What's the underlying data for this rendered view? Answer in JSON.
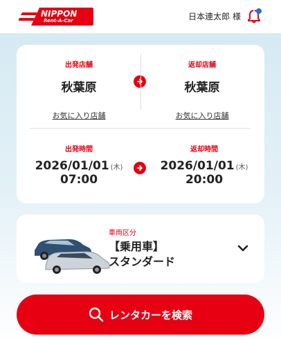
{
  "header": {
    "logo_main": "NIPPON",
    "logo_sub": "Rent-A-Car",
    "user_name": "日本連太郎 様",
    "bell_icon": "bell-icon",
    "notification_dot": true
  },
  "departure_store": {
    "label": "出発店舗",
    "name": "秋葉原",
    "favorite_link": "お気に入り店舗"
  },
  "return_store": {
    "label": "返却店舗",
    "name": "秋葉原",
    "favorite_link": "お気に入り店舗"
  },
  "departure_time": {
    "label": "出発時間",
    "date": "2026/01/01",
    "dow": "(木)",
    "time": "07:00"
  },
  "return_time": {
    "label": "返却時間",
    "date": "2026/01/01",
    "dow": "(木)",
    "time": "20:00"
  },
  "vehicle": {
    "label": "車両区分",
    "line1": "【乗用車】",
    "line2": "スタンダード"
  },
  "search": {
    "label": "レンタカーを検索"
  },
  "colors": {
    "accent": "#e60012",
    "background_top": "#d6eaf3",
    "card": "#ffffff"
  }
}
